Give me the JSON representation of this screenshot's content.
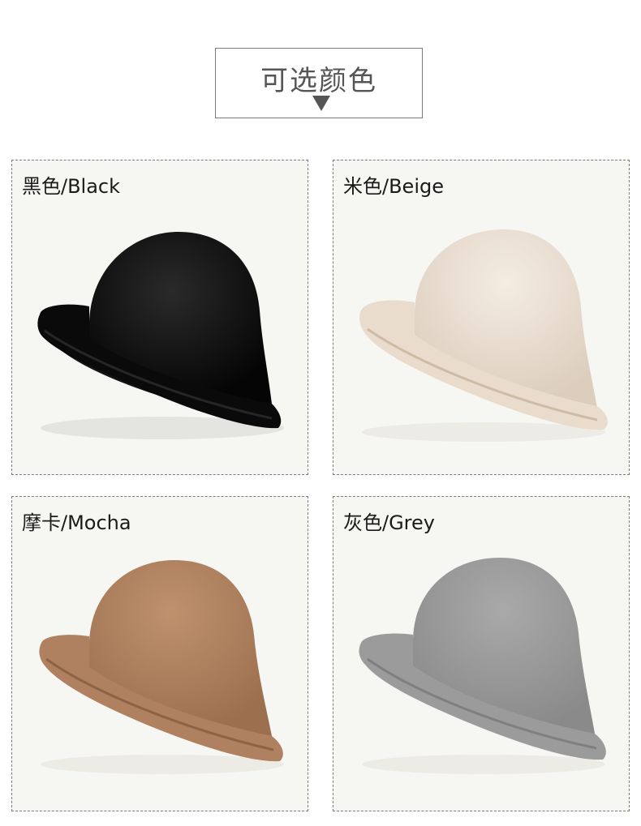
{
  "header": {
    "title": "可选颜色"
  },
  "colors": [
    {
      "label": "黑色/Black",
      "color": "#0d0d0d"
    },
    {
      "label": "米色/Beige",
      "color": "#ece2d6"
    },
    {
      "label": "摩卡/Mocha",
      "color": "#b08160"
    },
    {
      "label": "灰色/Grey",
      "color": "#9b9b9b"
    }
  ]
}
